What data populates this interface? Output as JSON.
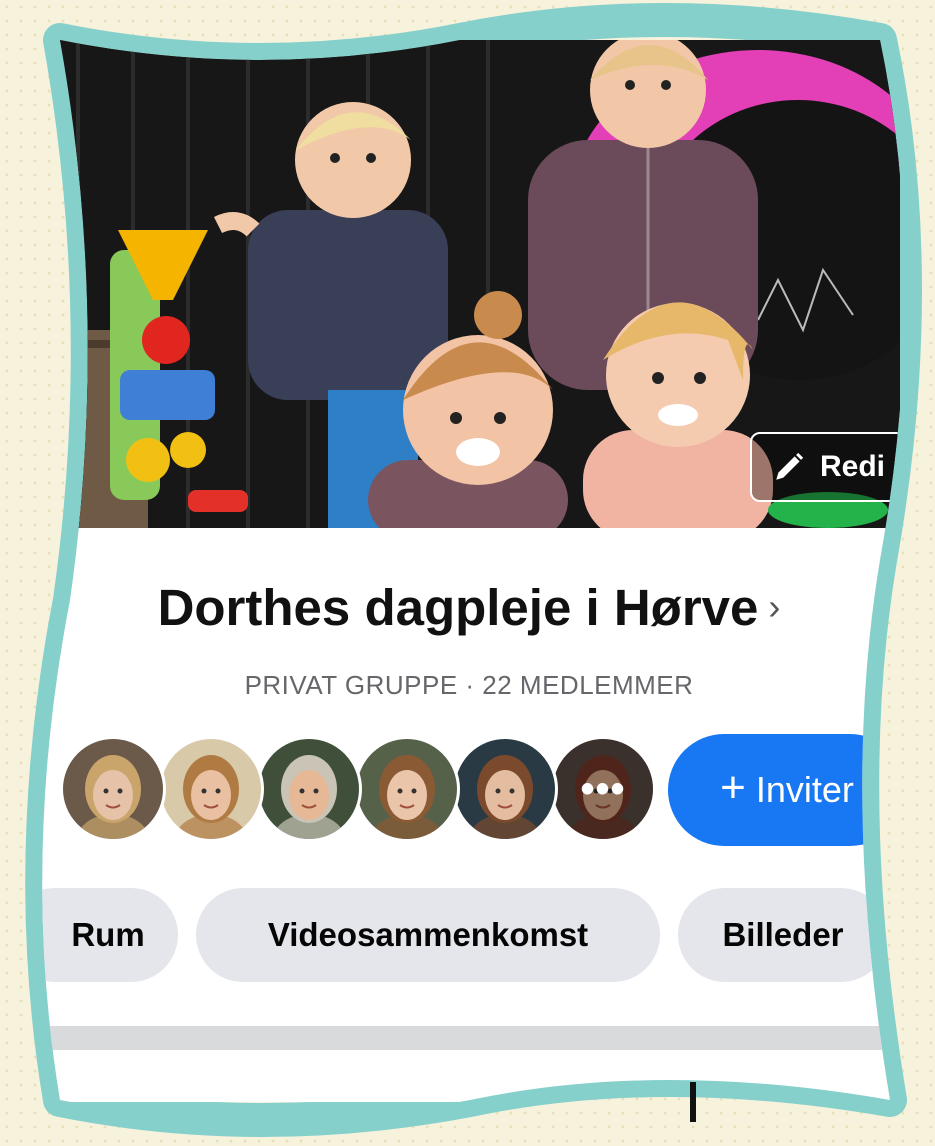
{
  "cover": {
    "edit_label": "Redi",
    "edit_icon": "pencil-icon"
  },
  "group": {
    "name": "Dorthes dagpleje i Hørve",
    "chevron": "›",
    "meta": "PRIVAT GRUPPE · 22 MEDLEMMER"
  },
  "members": {
    "more_label": "•••",
    "avatars": [
      {
        "name": "member-avatar-1",
        "bg": "#6b5a4a",
        "face": "#e6c3a8",
        "hair": "#c9a46b"
      },
      {
        "name": "member-avatar-2",
        "bg": "#d8c9a8",
        "face": "#e9c0a2",
        "hair": "#b07a43"
      },
      {
        "name": "member-avatar-3",
        "bg": "#3f4f3a",
        "face": "#e6b896",
        "hair": "#c9c4b6"
      },
      {
        "name": "member-avatar-4",
        "bg": "#56614a",
        "face": "#eac5aa",
        "hair": "#8a5a35"
      },
      {
        "name": "member-avatar-5",
        "bg": "#2a3a44",
        "face": "#e4bca0",
        "hair": "#7b4a2c"
      },
      {
        "name": "member-avatar-6",
        "bg": "#5a4c44",
        "face": "#dfae8e",
        "hair": "#7a3a2a"
      }
    ]
  },
  "invite": {
    "plus": "+",
    "label": "Inviter"
  },
  "tabs": [
    {
      "label": "Rum"
    },
    {
      "label": "Videosammenkomst"
    },
    {
      "label": "Billeder"
    }
  ],
  "colors": {
    "frame": "#86d0cc",
    "accent": "#1877f2",
    "chip_bg": "#e4e6eb"
  }
}
